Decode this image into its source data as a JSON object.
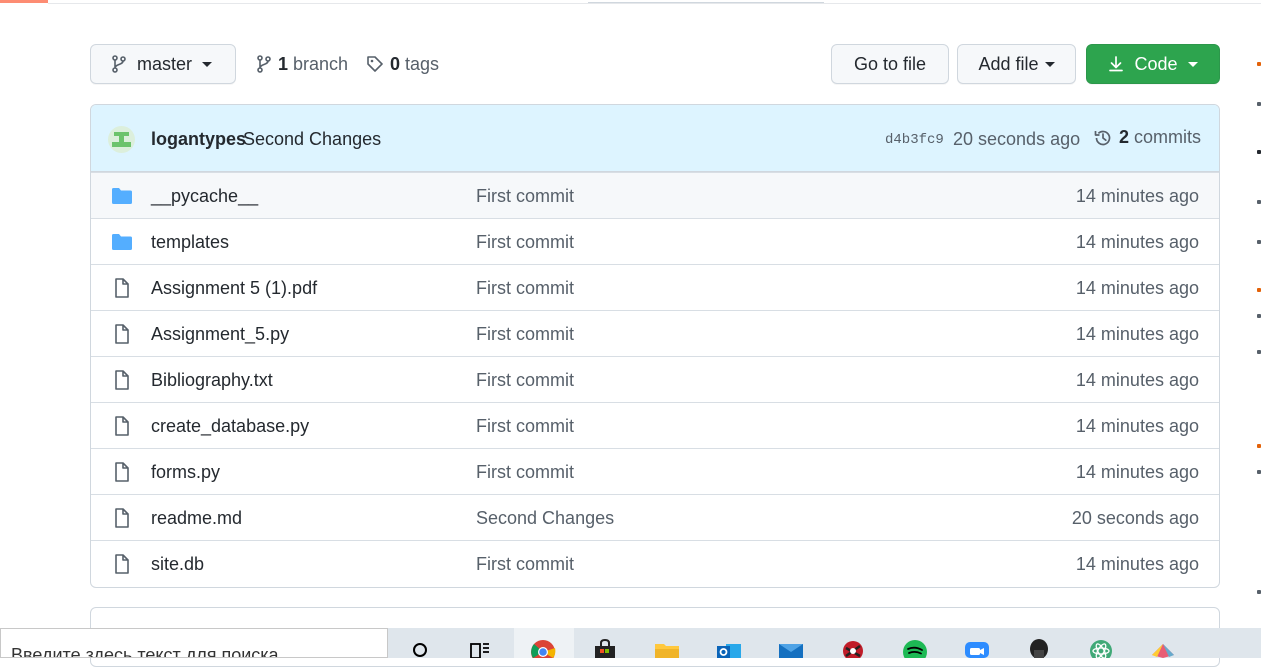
{
  "colors": {
    "primary_button": "#2da44e",
    "commit_header_bg": "#ddf4ff",
    "folder_icon": "#54aeff",
    "muted_text": "#57606a",
    "border": "#d0d7de"
  },
  "toolbar": {
    "branch_select": {
      "label": "master",
      "icon": "git-branch-icon"
    },
    "branches": {
      "count": "1",
      "label": "branch",
      "icon": "git-branch-icon"
    },
    "tags": {
      "count": "0",
      "label": "tags",
      "icon": "tag-icon"
    },
    "go_to_file": "Go to file",
    "add_file": "Add file",
    "code": {
      "label": "Code",
      "icon": "download-icon"
    }
  },
  "latest_commit": {
    "author": "logantypes",
    "message": "Second Changes",
    "sha": "d4b3fc9",
    "time": "20 seconds ago",
    "commits_count": "2",
    "commits_label": "commits",
    "icon": "history-icon"
  },
  "files": [
    {
      "type": "dir",
      "name": "__pycache__",
      "message": "First commit",
      "time": "14 minutes ago"
    },
    {
      "type": "dir",
      "name": "templates",
      "message": "First commit",
      "time": "14 minutes ago"
    },
    {
      "type": "file",
      "name": "Assignment 5 (1).pdf",
      "message": "First commit",
      "time": "14 minutes ago"
    },
    {
      "type": "file",
      "name": "Assignment_5.py",
      "message": "First commit",
      "time": "14 minutes ago"
    },
    {
      "type": "file",
      "name": "Bibliography.txt",
      "message": "First commit",
      "time": "14 minutes ago"
    },
    {
      "type": "file",
      "name": "create_database.py",
      "message": "First commit",
      "time": "14 minutes ago"
    },
    {
      "type": "file",
      "name": "forms.py",
      "message": "First commit",
      "time": "14 minutes ago"
    },
    {
      "type": "file",
      "name": "readme.md",
      "message": "Second Changes",
      "time": "20 seconds ago"
    },
    {
      "type": "file",
      "name": "site.db",
      "message": "First commit",
      "time": "14 minutes ago"
    }
  ],
  "taskbar": {
    "search_placeholder": "Введите здесь текст для поиска",
    "icons": [
      "search-icon",
      "task-view-icon",
      "chrome-icon",
      "store-icon",
      "file-explorer-icon",
      "outlook-icon",
      "mail-icon",
      "app-icon",
      "spotify-icon",
      "zoom-icon",
      "app-icon",
      "atom-icon",
      "app-icon"
    ]
  }
}
